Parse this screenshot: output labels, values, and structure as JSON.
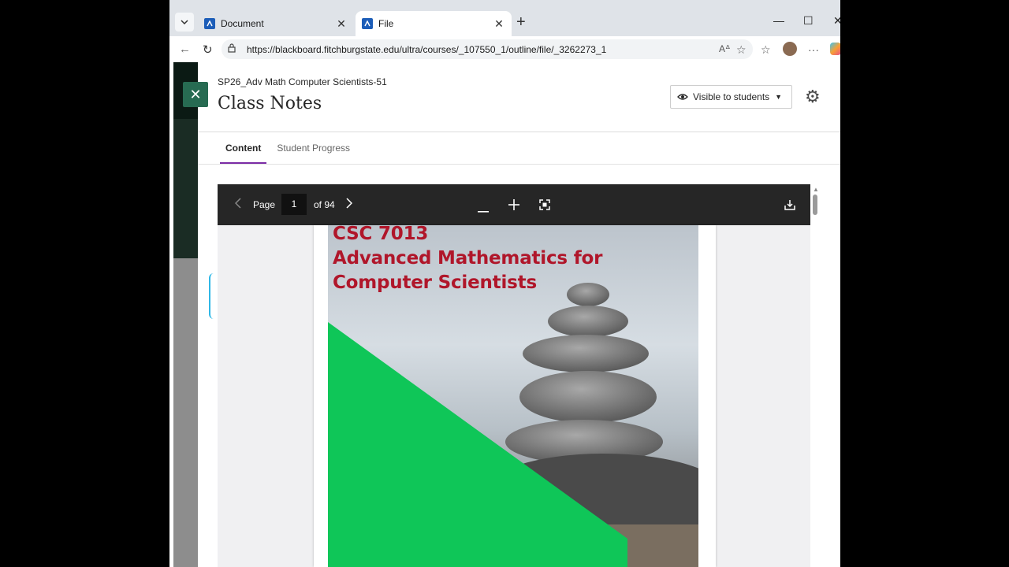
{
  "browser": {
    "tabs": [
      {
        "title": "Document",
        "active": false
      },
      {
        "title": "File",
        "active": true
      }
    ],
    "url": "https://blackboard.fitchburgstate.edu/ultra/courses/_107550_1/outline/file/_3262273_1"
  },
  "panel": {
    "course_name": "SP26_Adv Math Computer Scientists-51",
    "title": "Class Notes",
    "visibility_label": "Visible to students",
    "tabs": [
      {
        "label": "Content",
        "active": true
      },
      {
        "label": "Student Progress",
        "active": false
      }
    ]
  },
  "viewer": {
    "page_label": "Page",
    "current_page": "1",
    "of_label": "of 94"
  },
  "document": {
    "cover_lines": [
      "CSC 7013",
      "Advanced Mathematics for",
      "Computer Scientists"
    ]
  },
  "colors": {
    "accent_tab": "#7b2ca5",
    "close_button": "#276b52",
    "cover_title": "#b0162a",
    "cover_green": "#0fc658"
  }
}
